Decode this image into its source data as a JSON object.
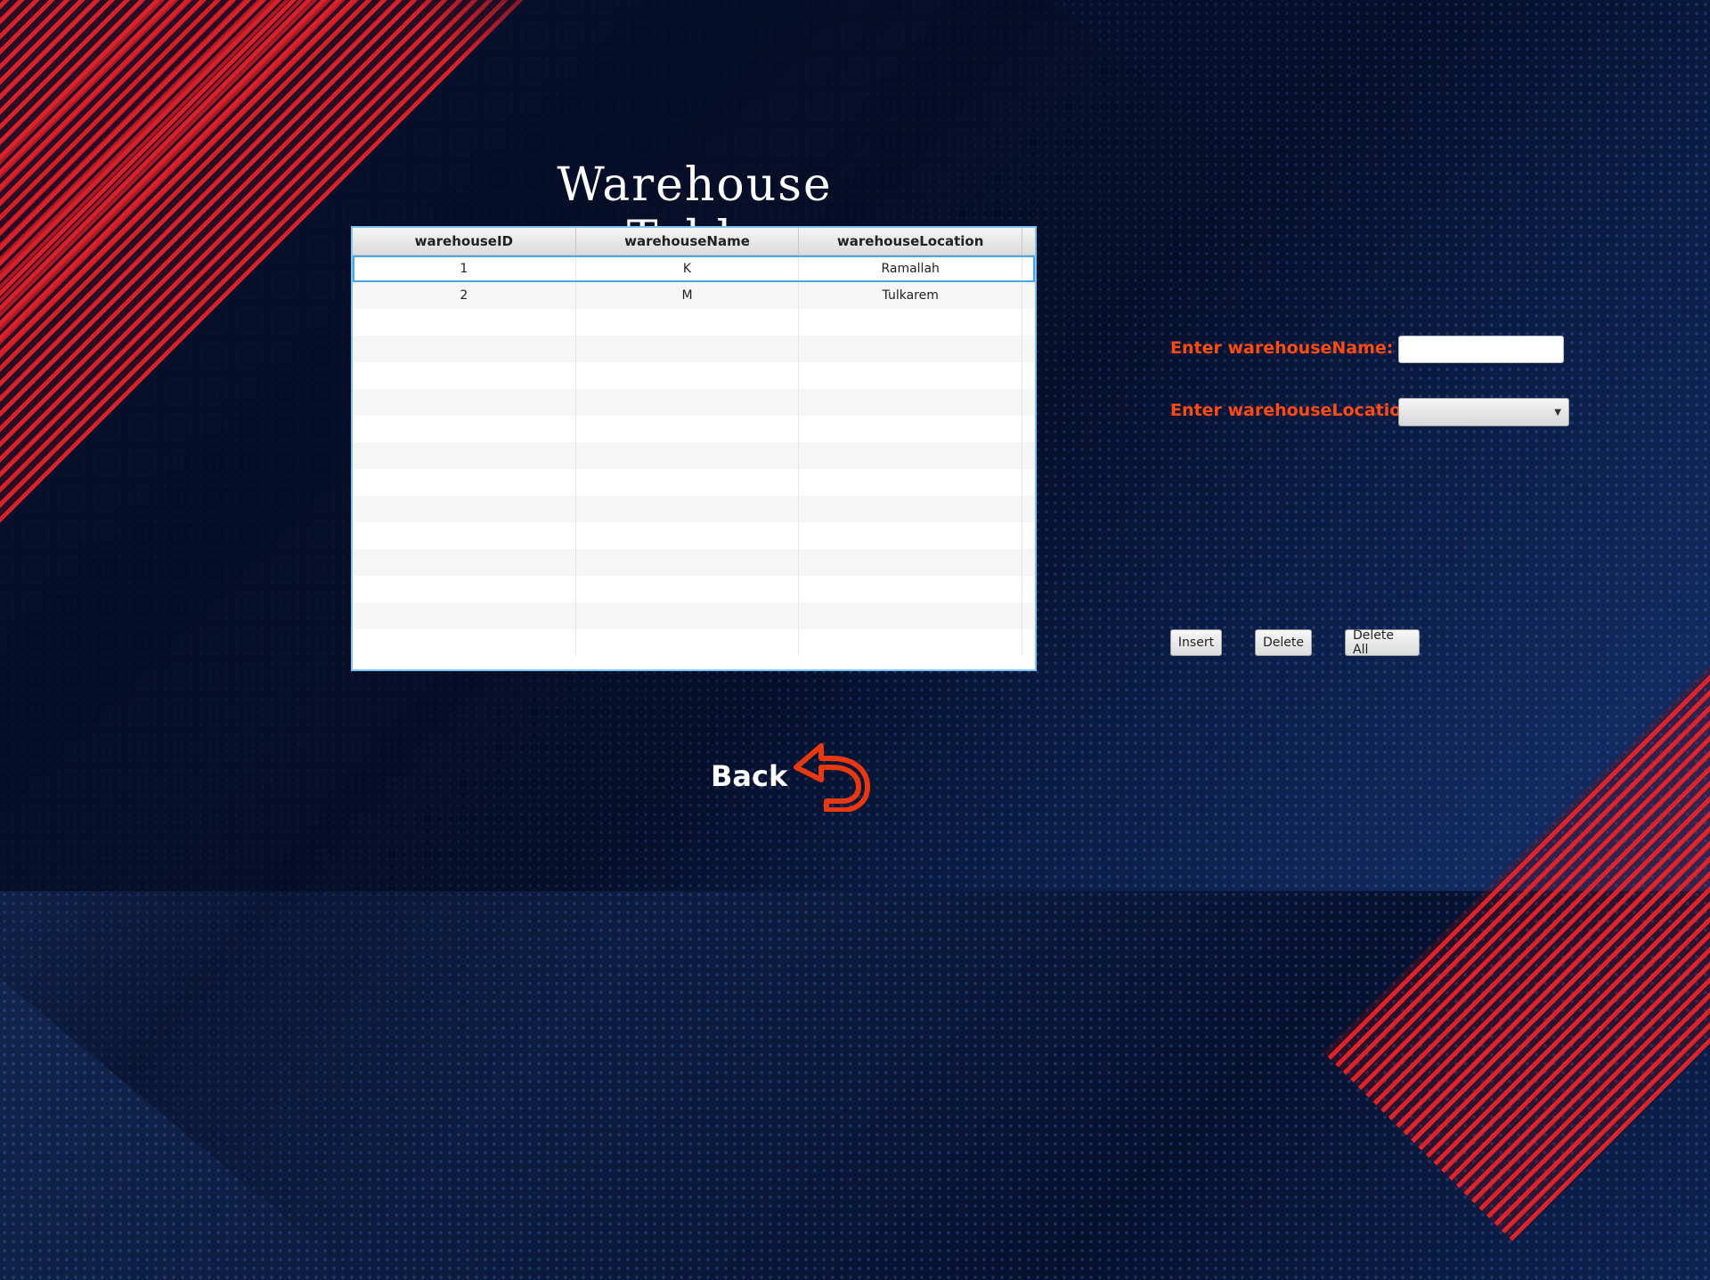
{
  "title": "Warehouse Table",
  "table": {
    "columns": [
      "warehouseID",
      "warehouseName",
      "warehouseLocation"
    ],
    "rows": [
      [
        "1",
        "K",
        "Ramallah"
      ],
      [
        "2",
        "M",
        "Tulkarem"
      ]
    ],
    "selected_row": 0
  },
  "form": {
    "name_label": "Enter warehouseName:",
    "name_value": "",
    "location_label": "Enter warehouseLocation:",
    "location_value": ""
  },
  "buttons": {
    "insert": "Insert",
    "delete": "Delete",
    "delete_all": "Delete All"
  },
  "back": {
    "label": "Back",
    "icon": "back-arrow-icon",
    "icon_color": "#e8380f"
  },
  "colors": {
    "label_accent": "#ff4a12",
    "table_border": "#7cc3ef",
    "background": "#0b1a3d",
    "stripe": "#e8242a"
  }
}
